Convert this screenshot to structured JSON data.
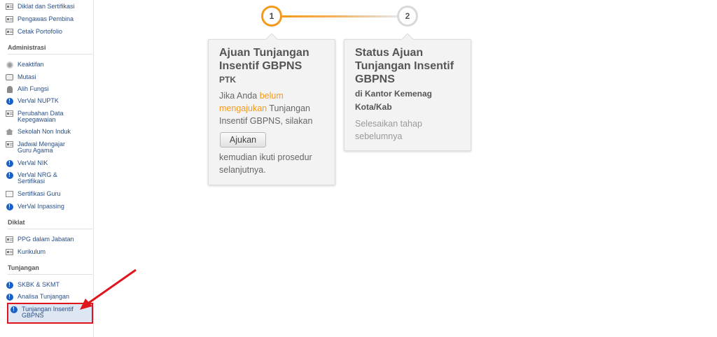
{
  "sidebar": {
    "top_items": [
      {
        "label": "Diklat dan Sertifikasi",
        "icon": "document-icon"
      },
      {
        "label": "Pengawas Pembina",
        "icon": "document-icon"
      },
      {
        "label": "Cetak Portofolio",
        "icon": "document-icon"
      }
    ],
    "sections": {
      "administrasi": "Administrasi",
      "diklat": "Diklat",
      "tunjangan": "Tunjangan"
    },
    "administrasi_items": [
      {
        "label": "Keaktifan",
        "icon": "gear-icon"
      },
      {
        "label": "Mutasi",
        "icon": "swap-icon"
      },
      {
        "label": "Alih Fungsi",
        "icon": "person-icon"
      },
      {
        "label": "VerVal NUPTK",
        "icon": "info-icon"
      },
      {
        "label_line1": "Perubahan Data",
        "label_line2": "Kepegawaian",
        "icon": "document-icon"
      },
      {
        "label": "Sekolah Non Induk",
        "icon": "school-icon"
      },
      {
        "label_line1": "Jadwal Mengajar",
        "label_line2": "Guru Agama",
        "icon": "document-icon"
      },
      {
        "label": "VerVal NIK",
        "icon": "info-icon"
      },
      {
        "label_line1": "VerVal NRG &",
        "label_line2": "Sertifikasi",
        "icon": "info-icon"
      },
      {
        "label": "Sertifikasi Guru",
        "icon": "certificate-icon"
      },
      {
        "label": "VerVal Inpassing",
        "icon": "info-icon"
      }
    ],
    "diklat_items": [
      {
        "label": "PPG dalam Jabatan",
        "icon": "document-icon"
      },
      {
        "label": "Kurikulum",
        "icon": "document-icon"
      }
    ],
    "tunjangan_items": [
      {
        "label": "SKBK & SKMT",
        "icon": "info-icon"
      },
      {
        "label": "Analisa Tunjangan",
        "icon": "info-icon"
      },
      {
        "label_line1": "Tunjangan Insentif",
        "label_line2": "GBPNS",
        "icon": "info-icon"
      }
    ]
  },
  "stepper": {
    "step1_number": "1",
    "step2_number": "2",
    "active_color": "#f39a1c",
    "inactive_color": "#d9d9d9"
  },
  "card1": {
    "title": "Ajuan Tunjangan Insentif GBPNS",
    "subtitle": "PTK",
    "text_before": "Jika Anda ",
    "text_highlight": "belum mengajukan",
    "text_after": " Tunjangan Insentif GBPNS, silakan",
    "button_label": "Ajukan",
    "text_end": "kemudian ikuti prosedur selanjutnya."
  },
  "card2": {
    "title": "Status Ajuan Tunjangan Insentif GBPNS",
    "subtitle": "di Kantor Kemenag Kota/Kab",
    "text": "Selesaikan tahap sebelumnya"
  },
  "colors": {
    "highlight_border": "#e0141c",
    "link": "#2a4f86",
    "accent": "#f39a1c"
  }
}
